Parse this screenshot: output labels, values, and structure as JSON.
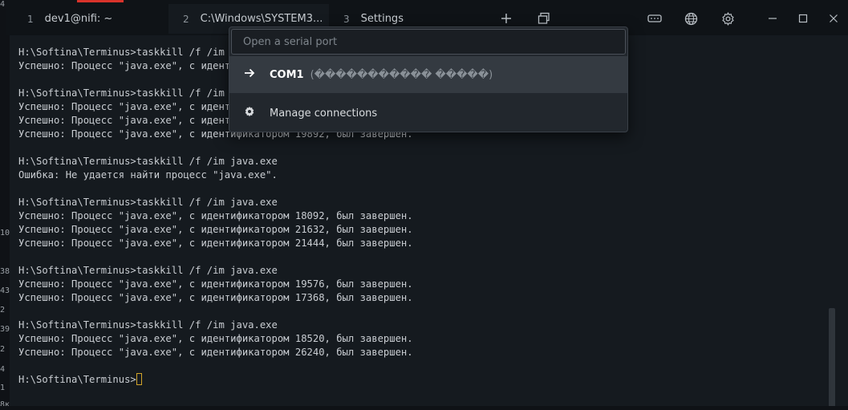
{
  "tabs": [
    {
      "num": "1",
      "title": "dev1@nifi: ~"
    },
    {
      "num": "2",
      "title": "C:\\Windows\\SYSTEM3..."
    },
    {
      "num": "3",
      "title": "Settings"
    }
  ],
  "bg_margin": [
    "4",
    "10",
    "38",
    "43",
    "2",
    "39",
    "2",
    "4",
    "1",
    "8кв"
  ],
  "dialog": {
    "placeholder": "Open a serial port",
    "option1_label": "COM1",
    "option1_desc": "(����������� �����)",
    "option2_label": "Manage connections"
  },
  "terminal_lines": [
    "H:\\Softina\\Terminus>taskkill /f /im java.exe",
    "Успешно: Процесс \"java.exe\", с идентификатором 19164, был завершен.",
    "",
    "H:\\Softina\\Terminus>taskkill /f /im java.exe",
    "Успешно: Процесс \"java.exe\", с идентификатором 19652, был завершен.",
    "Успешно: Процесс \"java.exe\", с идентификатором 19384, был завершен.",
    "Успешно: Процесс \"java.exe\", с идентификатором 19892, был завершен.",
    "",
    "H:\\Softina\\Terminus>taskkill /f /im java.exe",
    "Ошибка: Не удается найти процесс \"java.exe\".",
    "",
    "H:\\Softina\\Terminus>taskkill /f /im java.exe",
    "Успешно: Процесс \"java.exe\", с идентификатором 18092, был завершен.",
    "Успешно: Процесс \"java.exe\", с идентификатором 21632, был завершен.",
    "Успешно: Процесс \"java.exe\", с идентификатором 21444, был завершен.",
    "",
    "H:\\Softina\\Terminus>taskkill /f /im java.exe",
    "Успешно: Процесс \"java.exe\", с идентификатором 19576, был завершен.",
    "Успешно: Процесс \"java.exe\", с идентификатором 17368, был завершен.",
    "",
    "H:\\Softina\\Terminus>taskkill /f /im java.exe",
    "Успешно: Процесс \"java.exe\", с идентификатором 18520, был завершен.",
    "Успешно: Процесс \"java.exe\", с идентификатором 26240, был завершен.",
    ""
  ],
  "prompt": "H:\\Softina\\Terminus>"
}
